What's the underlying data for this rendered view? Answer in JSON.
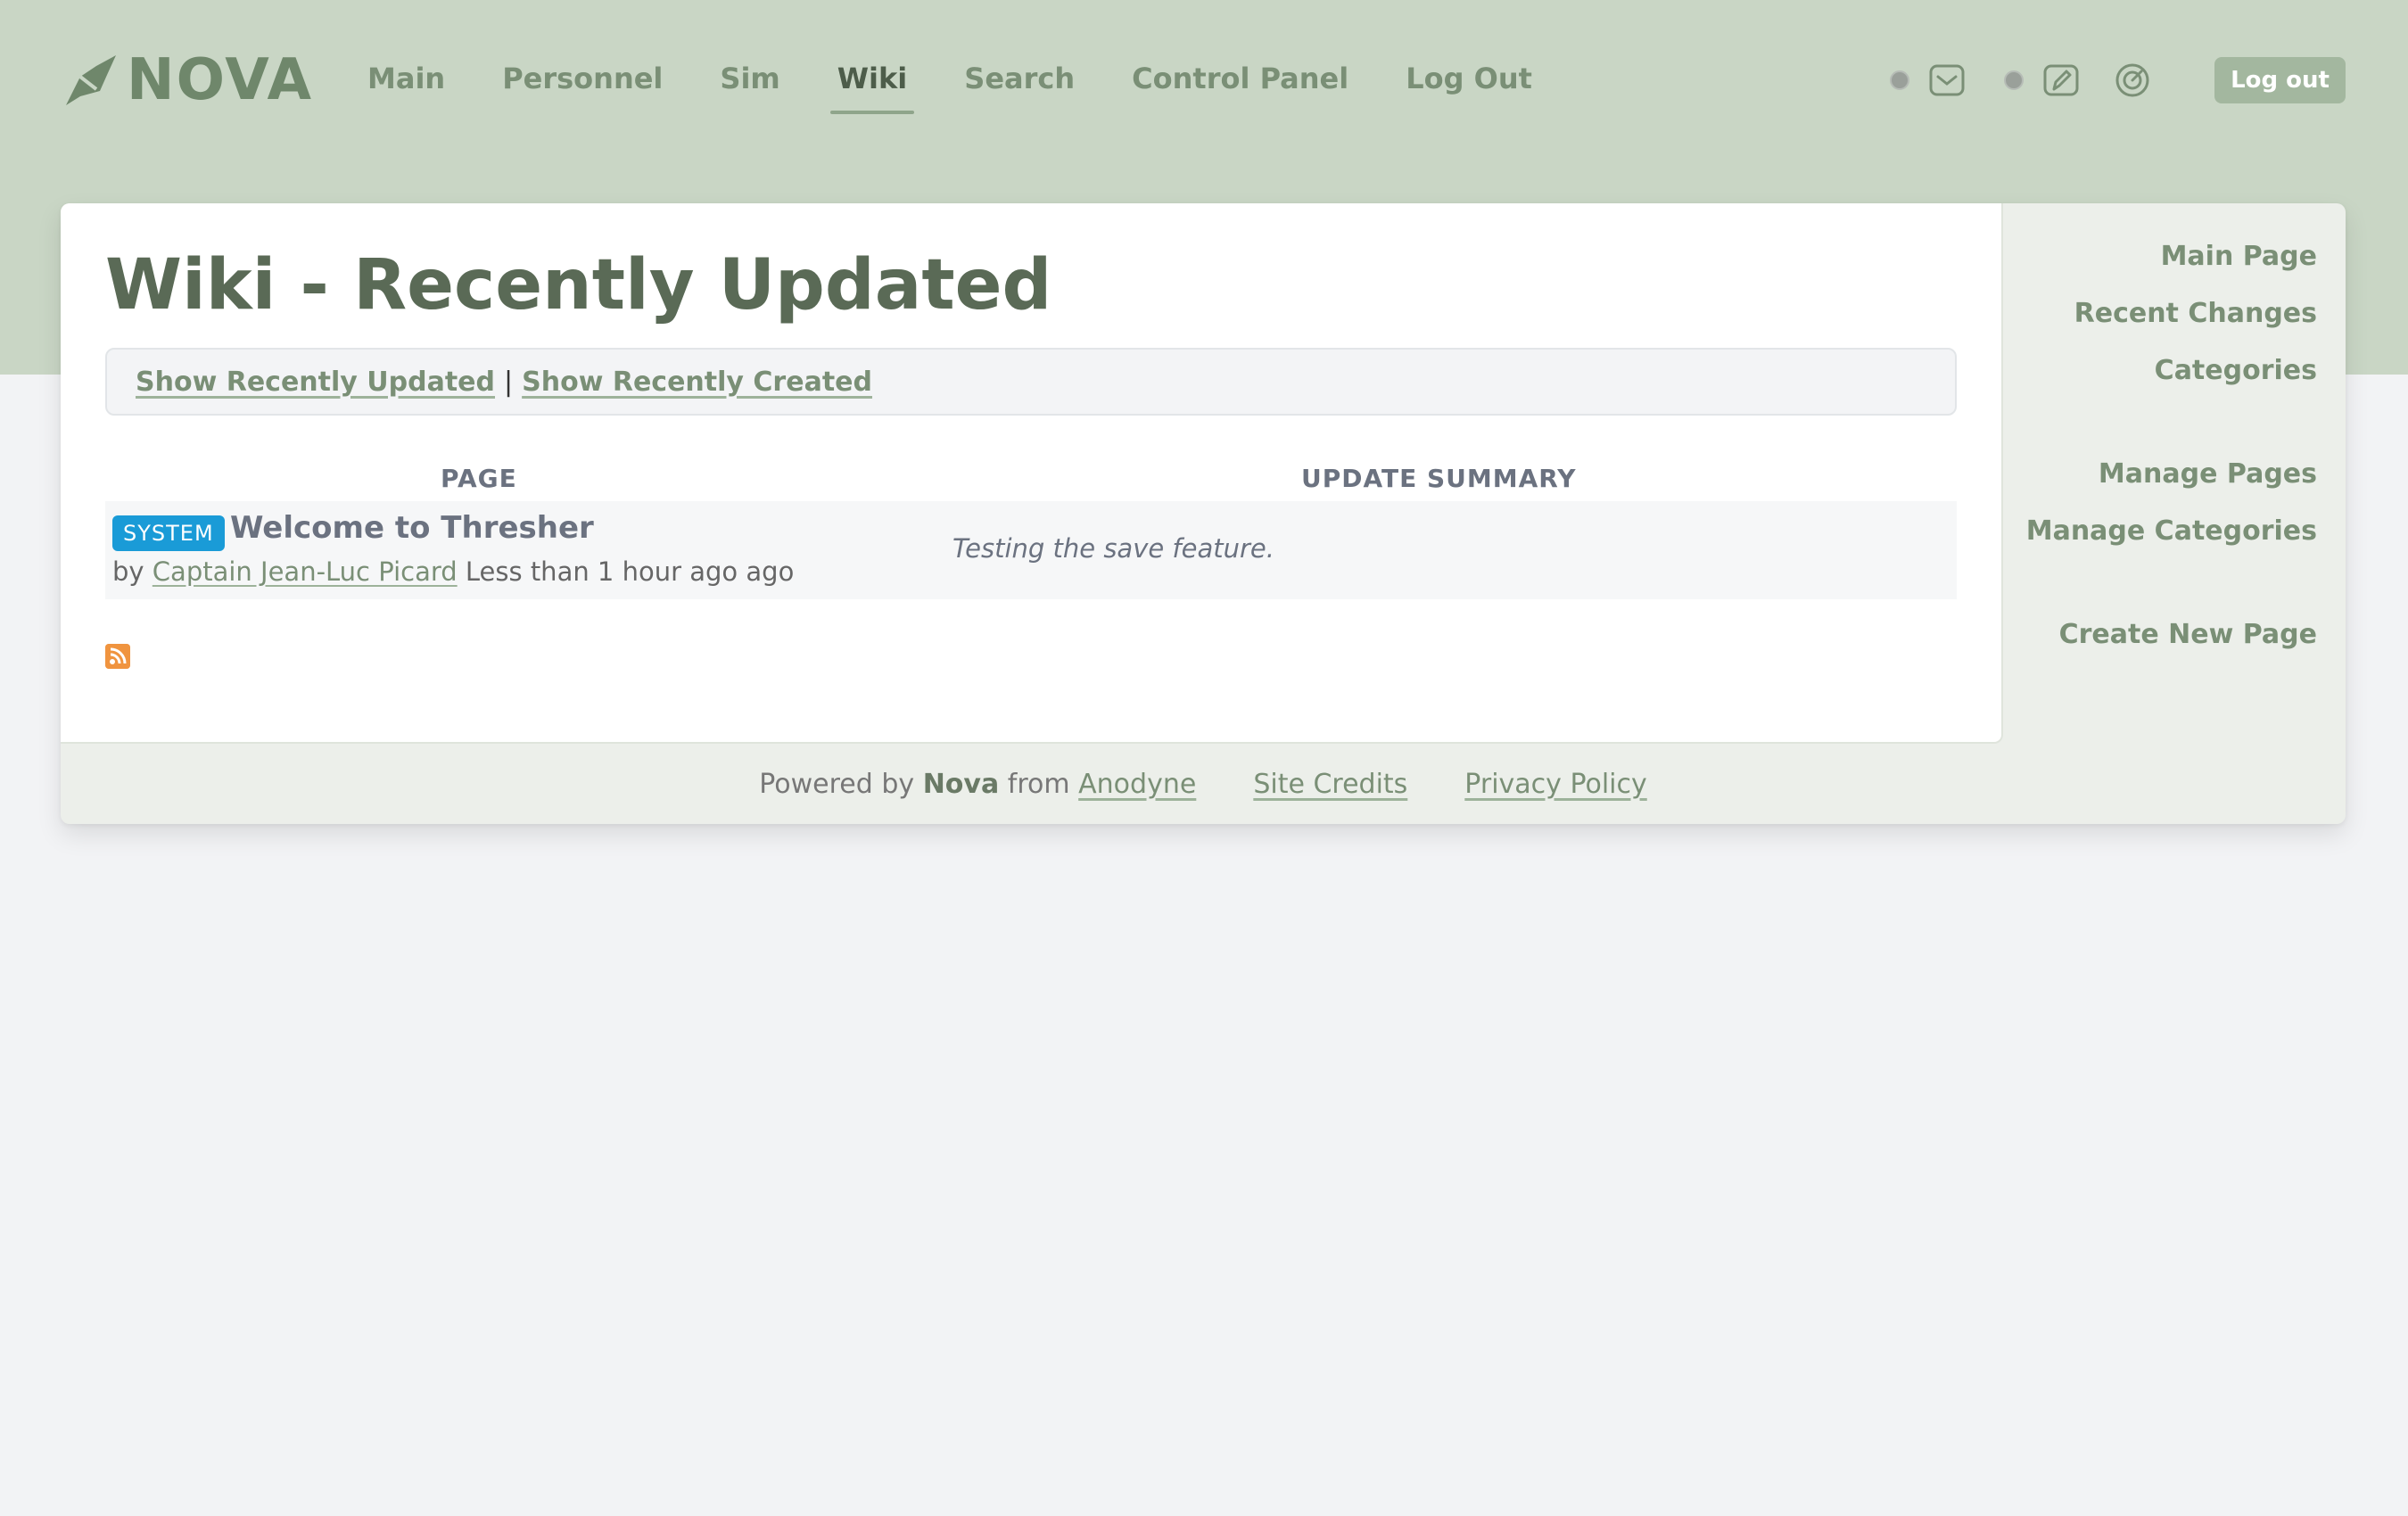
{
  "brand": {
    "name": "NOVA"
  },
  "nav": {
    "items": [
      {
        "label": "Main"
      },
      {
        "label": "Personnel"
      },
      {
        "label": "Sim"
      },
      {
        "label": "Wiki"
      },
      {
        "label": "Search"
      },
      {
        "label": "Control Panel"
      },
      {
        "label": "Log Out"
      }
    ],
    "active": "Wiki",
    "icons": [
      "mail-icon",
      "edit-icon",
      "target-icon"
    ],
    "logout_button": "Log out"
  },
  "page": {
    "title": "Wiki - Recently Updated",
    "filters": {
      "recently_updated": "Show Recently Updated",
      "separator": "|",
      "recently_created": "Show Recently Created"
    }
  },
  "table": {
    "headers": {
      "page": "PAGE",
      "summary": "UPDATE SUMMARY"
    },
    "rows": [
      {
        "badge": "SYSTEM",
        "title": "Welcome to Thresher",
        "by_label": "by",
        "author": "Captain Jean-Luc Picard",
        "time": "Less than 1 hour ago ago",
        "summary": "Testing the save feature."
      }
    ]
  },
  "sidebar": {
    "groups": [
      [
        "Main Page",
        "Recent Changes",
        "Categories"
      ],
      [
        "Manage Pages",
        "Manage Categories"
      ],
      [
        "Create New Page"
      ]
    ]
  },
  "footer": {
    "powered_by": "Powered by",
    "nova": "Nova",
    "from": "from",
    "anodyne": "Anodyne",
    "site_credits": "Site Credits",
    "privacy_policy": "Privacy Policy"
  },
  "colors": {
    "header_bg": "#c9d6c5",
    "accent": "#7a8f76",
    "badge_system": "#1a9bd7",
    "rss": "#f0943f"
  }
}
